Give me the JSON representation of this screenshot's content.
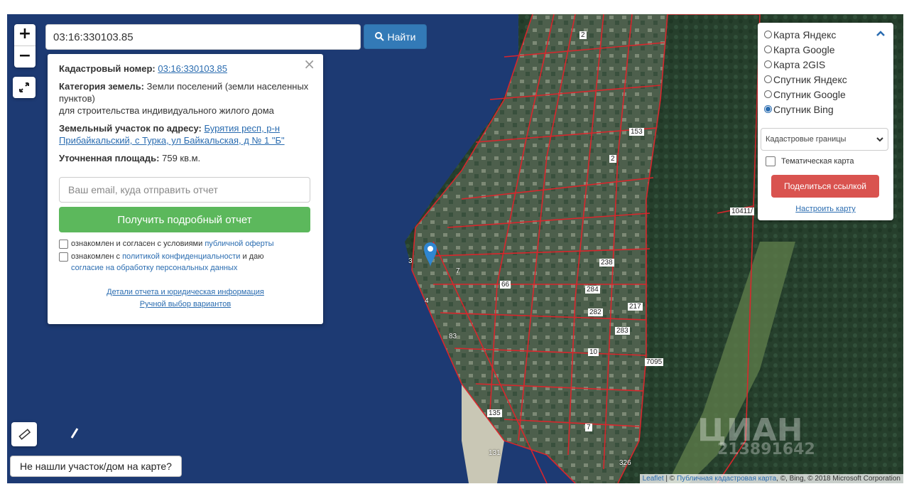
{
  "search": {
    "value": "03:16:330103.85",
    "button_label": "Найти"
  },
  "zoom": {
    "in": "+",
    "out": "−"
  },
  "info": {
    "cadastral_label": "Кадастровый номер:",
    "cadastral_value": "03:16:330103.85",
    "category_label": "Категория земель:",
    "category_value": "Земли поселений (земли населенных пунктов)",
    "usage": "для строительства индивидуального жилого дома",
    "address_label": "Земельный участок по адресу:",
    "address_value": "Бурятия респ, р-н Прибайкальский, с Турка, ул Байкальская, д № 1 \"Б\"",
    "area_label": "Уточненная площадь:",
    "area_value": "759 кв.м.",
    "email_placeholder": "Ваш email, куда отправить отчет",
    "report_button": "Получить подробный отчет",
    "agree1_text": "ознакомлен и согласен с условиями ",
    "agree1_link": "публичной оферты",
    "agree2_text": "ознакомлен с ",
    "agree2_link": "политикой конфиденциальности",
    "agree2_tail": " и даю",
    "agree2_link2": "согласие на обработку персональных данных",
    "details_link": "Детали отчета и юридическая информация",
    "manual_link": "Ручной выбор вариантов"
  },
  "layers": {
    "options": [
      {
        "label": "Карта Яндекс",
        "selected": false
      },
      {
        "label": "Карта Google",
        "selected": false
      },
      {
        "label": "Карта 2GIS",
        "selected": false
      },
      {
        "label": "Спутник Яндекс",
        "selected": false
      },
      {
        "label": "Спутник Google",
        "selected": false
      },
      {
        "label": "Спутник Bing",
        "selected": true
      }
    ],
    "overlay_select": "Кадастровые границы",
    "thematic_label": "Тематическая карта",
    "share_button": "Поделиться ссылкой",
    "setup_link": "Настроить карту"
  },
  "not_found_button": "Не нашли участок/дом на карте?",
  "attribution": {
    "leaflet": "Leaflet",
    "sep": " | © ",
    "link": "Публичная кадастровая карта",
    "tail": ", ©, Bing, © 2018 Microsoft Corporation"
  },
  "watermark": {
    "brand": "ЦИАН",
    "id": "213891642"
  },
  "map_labels": [
    "2",
    "153",
    "2",
    "10411/",
    "7",
    "66",
    "238",
    "284",
    "282",
    "217",
    "283",
    "10",
    "7095",
    "3",
    "4",
    "83",
    "135",
    "131",
    "326",
    "7"
  ],
  "colors": {
    "boundary": "#e0242b",
    "water": "#1d3a73",
    "primary": "#337ab7",
    "success": "#5cb85c",
    "danger": "#d9534f"
  }
}
